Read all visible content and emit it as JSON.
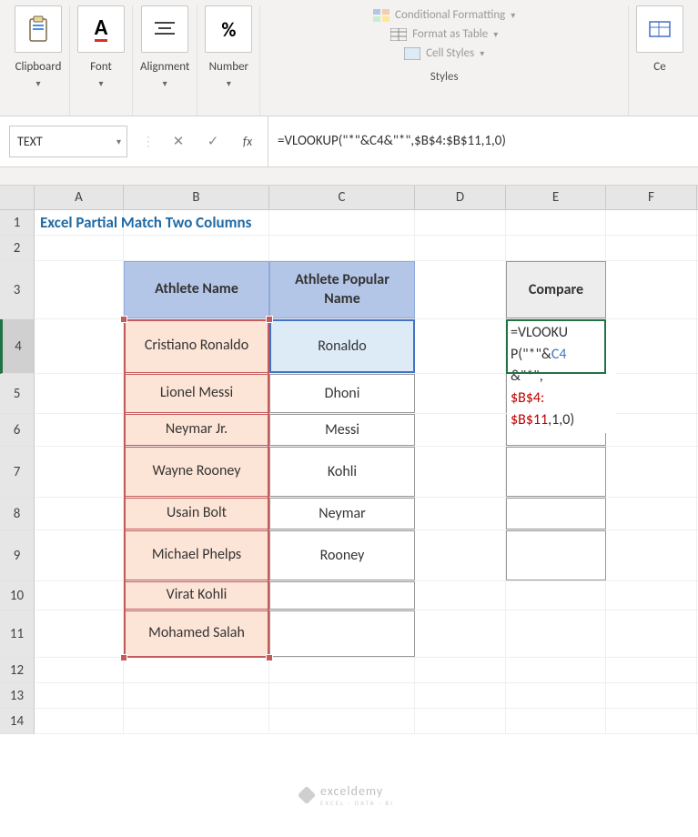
{
  "ribbon": {
    "clipboard": "Clipboard",
    "font": "Font",
    "alignment": "Alignment",
    "number": "Number",
    "cond_format": "Conditional Formatting",
    "format_table": "Format as Table",
    "cell_styles": "Cell Styles",
    "styles_label": "Styles",
    "cells": "Ce",
    "font_letter": "A",
    "percent": "%"
  },
  "name_box": "TEXT",
  "fx": "fx",
  "formula_bar": "=VLOOKUP(\"*\"&C4&\"*\",$B$4:$B$11,1,0)",
  "cols": {
    "A": "A",
    "B": "B",
    "C": "C",
    "D": "D",
    "E": "E",
    "F": "F"
  },
  "rows": [
    "1",
    "2",
    "3",
    "4",
    "5",
    "6",
    "7",
    "8",
    "9",
    "10",
    "11",
    "12",
    "13",
    "14"
  ],
  "title": "Excel Partial Match Two Columns",
  "headers": {
    "b": "Athlete Name",
    "c": "Athlete Popular Name",
    "e": "Compare"
  },
  "table": [
    {
      "b": "Cristiano Ronaldo",
      "c": "Ronaldo"
    },
    {
      "b": "Lionel Messi",
      "c": "Dhoni"
    },
    {
      "b": "Neymar Jr.",
      "c": "Messi"
    },
    {
      "b": "Wayne Rooney",
      "c": "Kohli"
    },
    {
      "b": "Usain Bolt",
      "c": "Neymar"
    },
    {
      "b": "Michael Phelps",
      "c": "Rooney"
    },
    {
      "b": "Virat Kohli",
      "c": ""
    },
    {
      "b": "Mohamed Salah",
      "c": ""
    }
  ],
  "formula_parts": {
    "p1": "=VLOOKU",
    "p2": "P(\"*\"&",
    "c4": "C4",
    "p3": "&\"*\",",
    "b1": "$B$4:",
    "b2": "$B$11",
    "p4": ",1,0)"
  },
  "watermark": {
    "text": "exceldemy",
    "sub": "EXCEL · DATA · BI"
  }
}
